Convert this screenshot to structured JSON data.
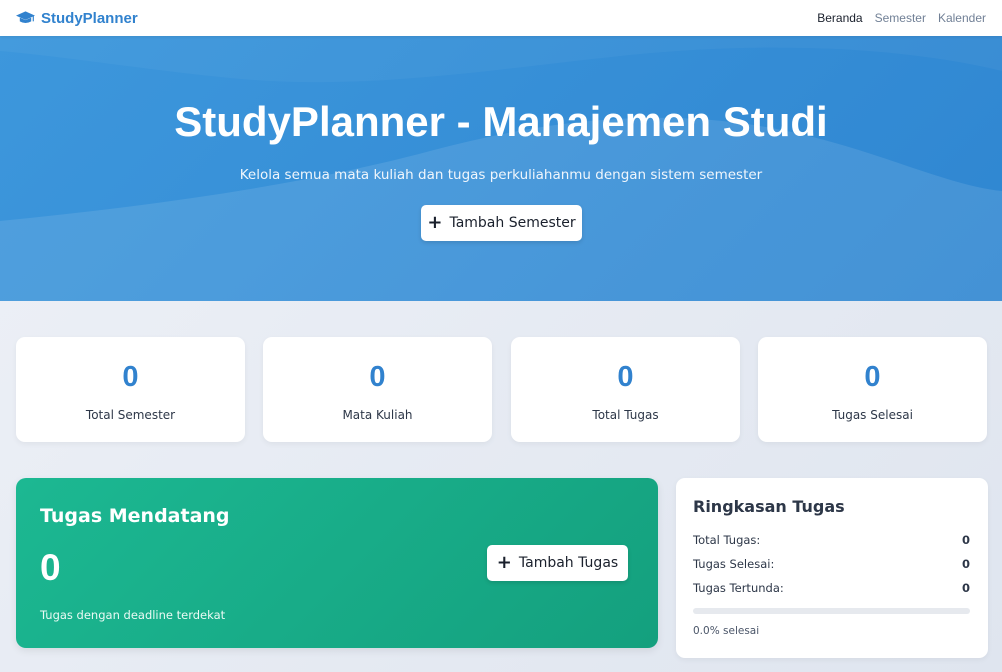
{
  "navbar": {
    "brand": "StudyPlanner",
    "brand_icon": "graduation-cap-icon",
    "links": [
      "Beranda",
      "Semester",
      "Kalender"
    ],
    "active_link": "Beranda"
  },
  "hero": {
    "title": "StudyPlanner - Manajemen Studi",
    "subtitle": "Kelola semua mata kuliah dan tugas perkuliahanmu dengan sistem semester",
    "button_label": "Tambah Semester",
    "button_icon": "plus-icon"
  },
  "stats": [
    {
      "value": "0",
      "label": "Total Semester"
    },
    {
      "value": "0",
      "label": "Mata Kuliah"
    },
    {
      "value": "0",
      "label": "Total Tugas"
    },
    {
      "value": "0",
      "label": "Tugas Selesai"
    }
  ],
  "upcoming": {
    "title": "Tugas Mendatang",
    "count": "0",
    "description": "Tugas dengan deadline terdekat",
    "button_label": "Tambah Tugas",
    "button_icon": "plus-icon"
  },
  "summary": {
    "title": "Ringkasan Tugas",
    "rows": [
      {
        "label": "Total Tugas:",
        "value": "0"
      },
      {
        "label": "Tugas Selesai:",
        "value": "0"
      },
      {
        "label": "Tugas Tertunda:",
        "value": "0"
      }
    ],
    "progress_percent": 0,
    "progress_text": "0.0% selesai"
  },
  "colors": {
    "primary": "#3182ce",
    "hero_bg": "#3d97dc",
    "success": "#1cb892"
  }
}
